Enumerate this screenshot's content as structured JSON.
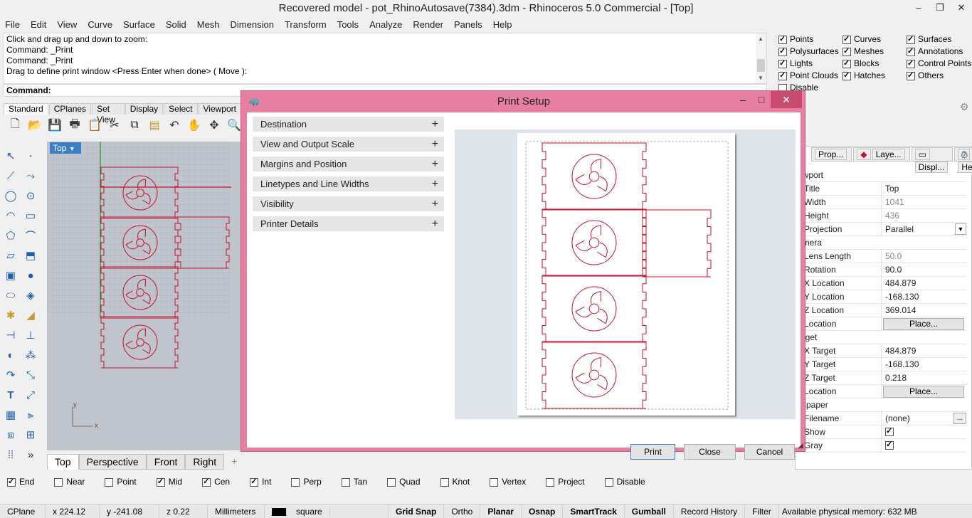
{
  "window": {
    "title": "Recovered model - pot_RhinoAutosave(7384).3dm - Rhinoceros 5.0 Commercial - [Top]",
    "minimize": "–",
    "maximize": "❐",
    "close": "✕"
  },
  "menu": [
    "File",
    "Edit",
    "View",
    "Curve",
    "Surface",
    "Solid",
    "Mesh",
    "Dimension",
    "Transform",
    "Tools",
    "Analyze",
    "Render",
    "Panels",
    "Help"
  ],
  "command": {
    "history": [
      "Click and drag up and down to zoom:",
      "Command: _Print",
      "Command: _Print",
      "Drag to define print window <Press Enter when done> ( Move ):"
    ],
    "prompt": "Command:"
  },
  "filters": [
    {
      "label": "Points",
      "checked": true
    },
    {
      "label": "Curves",
      "checked": true
    },
    {
      "label": "Surfaces",
      "checked": true
    },
    {
      "label": "Polysurfaces",
      "checked": true
    },
    {
      "label": "Meshes",
      "checked": true
    },
    {
      "label": "Annotations",
      "checked": true
    },
    {
      "label": "Lights",
      "checked": true
    },
    {
      "label": "Blocks",
      "checked": true
    },
    {
      "label": "Control Points",
      "checked": true
    },
    {
      "label": "Point Clouds",
      "checked": true
    },
    {
      "label": "Hatches",
      "checked": true
    },
    {
      "label": "Others",
      "checked": true
    },
    {
      "label": "Disable",
      "checked": false
    }
  ],
  "toolbar_tabs": [
    "Standard",
    "CPlanes",
    "Set View",
    "Display",
    "Select",
    "Viewport"
  ],
  "toolbar_icons": [
    "new-icon",
    "open-icon",
    "save-icon",
    "print-icon",
    "paste-template-icon",
    "cut-icon",
    "copy-icon",
    "paste-icon",
    "undo-icon",
    "pan-hand-icon",
    "rotate-view-icon",
    "zoom-icon"
  ],
  "viewport": {
    "label": "Top",
    "axis_x": "x",
    "axis_y": "y"
  },
  "viewport_tabs": [
    "Top",
    "Perspective",
    "Front",
    "Right"
  ],
  "viewport_tab_add": "+",
  "osnaps": [
    {
      "label": "End",
      "checked": true
    },
    {
      "label": "Near",
      "checked": false
    },
    {
      "label": "Point",
      "checked": false
    },
    {
      "label": "Mid",
      "checked": true
    },
    {
      "label": "Cen",
      "checked": true
    },
    {
      "label": "Int",
      "checked": true
    },
    {
      "label": "Perp",
      "checked": false
    },
    {
      "label": "Tan",
      "checked": false
    },
    {
      "label": "Quad",
      "checked": false
    },
    {
      "label": "Knot",
      "checked": false
    },
    {
      "label": "Vertex",
      "checked": false
    },
    {
      "label": "Project",
      "checked": false
    },
    {
      "label": "Disable",
      "checked": false
    }
  ],
  "status": {
    "cplane": "CPlane",
    "x": "x 224.12",
    "y": "y -241.08",
    "z": "z 0.22",
    "units": "Millimeters",
    "layer": "square",
    "grid_snap": "Grid Snap",
    "ortho": "Ortho",
    "planar": "Planar",
    "osnap": "Osnap",
    "smarttrack": "SmartTrack",
    "gumball": "Gumball",
    "record_history": "Record History",
    "filter": "Filter",
    "memory": "Available physical memory: 632 MB"
  },
  "right_panel": {
    "tabs": [
      "Prop...",
      "Laye...",
      "Displ...",
      "Help"
    ],
    "rows": [
      {
        "type": "section",
        "key": "ewport"
      },
      {
        "key": "Title",
        "value": "Top"
      },
      {
        "key": "Width",
        "value": "1041",
        "dim": true
      },
      {
        "key": "Height",
        "value": "436",
        "dim": true
      },
      {
        "key": "Projection",
        "value": "Parallel",
        "dropdown": true
      },
      {
        "type": "section",
        "key": "amera"
      },
      {
        "key": "Lens Length",
        "value": "50.0",
        "dim": true
      },
      {
        "key": "Rotation",
        "value": "90.0"
      },
      {
        "key": "X Location",
        "value": "484.879"
      },
      {
        "key": "Y Location",
        "value": "-168.130"
      },
      {
        "key": "Z Location",
        "value": "369.014"
      },
      {
        "key": "Location",
        "button": "Place..."
      },
      {
        "type": "section",
        "key": "arget"
      },
      {
        "key": "X Target",
        "value": "484.879"
      },
      {
        "key": "Y Target",
        "value": "-168.130"
      },
      {
        "key": "Z Target",
        "value": "0.218"
      },
      {
        "key": "Location",
        "button": "Place..."
      },
      {
        "type": "section",
        "key": "allpaper"
      },
      {
        "key": "Filename",
        "value": "(none)",
        "browse": "..."
      },
      {
        "key": "Show",
        "check": true
      },
      {
        "key": "Gray",
        "check": true
      }
    ]
  },
  "print_dialog": {
    "title": "Print Setup",
    "sections": [
      "Destination",
      "View and Output Scale",
      "Margins and Position",
      "Linetypes and Line Widths",
      "Visibility",
      "Printer Details"
    ],
    "expand_symbol": "+",
    "buttons": {
      "print": "Print",
      "close": "Close",
      "cancel": "Cancel"
    }
  },
  "colors": {
    "dialog_border": "#e67fa1",
    "curve": "#c8102e",
    "viewport_bg": "#bfc4cd",
    "accent": "#3a7ec4"
  }
}
